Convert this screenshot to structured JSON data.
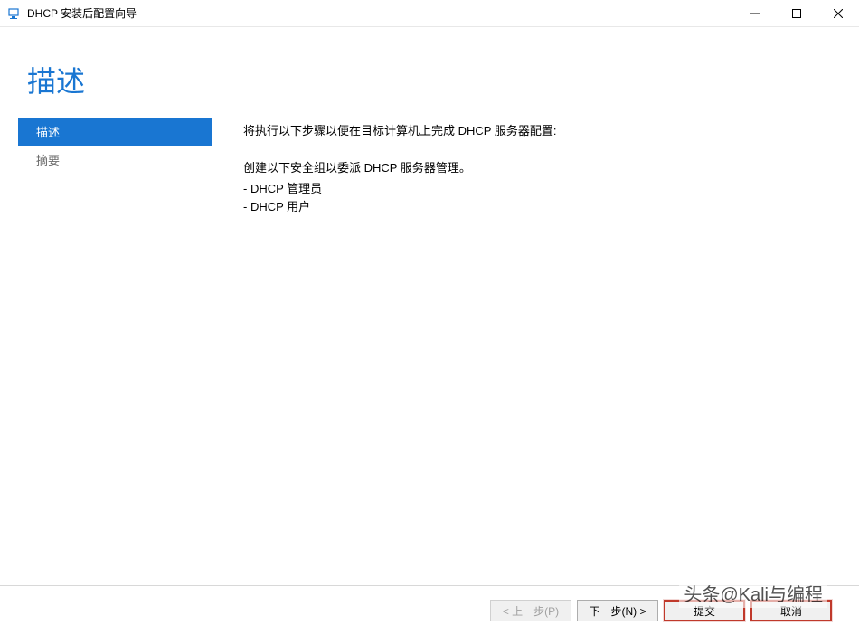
{
  "window": {
    "title": "DHCP 安装后配置向导"
  },
  "header": {
    "title": "描述"
  },
  "sidebar": {
    "items": [
      {
        "label": "描述",
        "active": true
      },
      {
        "label": "摘要",
        "active": false
      }
    ]
  },
  "content": {
    "intro": "将执行以下步骤以便在目标计算机上完成 DHCP 服务器配置:",
    "groups_intro": "创建以下安全组以委派 DHCP 服务器管理。",
    "groups": [
      "- DHCP 管理员",
      "- DHCP 用户"
    ]
  },
  "footer": {
    "previous_label": "< 上一步(P)",
    "next_label": "下一步(N) >",
    "commit_label": "提交",
    "cancel_label": "取消"
  },
  "watermark": "头条@Kali与编程"
}
